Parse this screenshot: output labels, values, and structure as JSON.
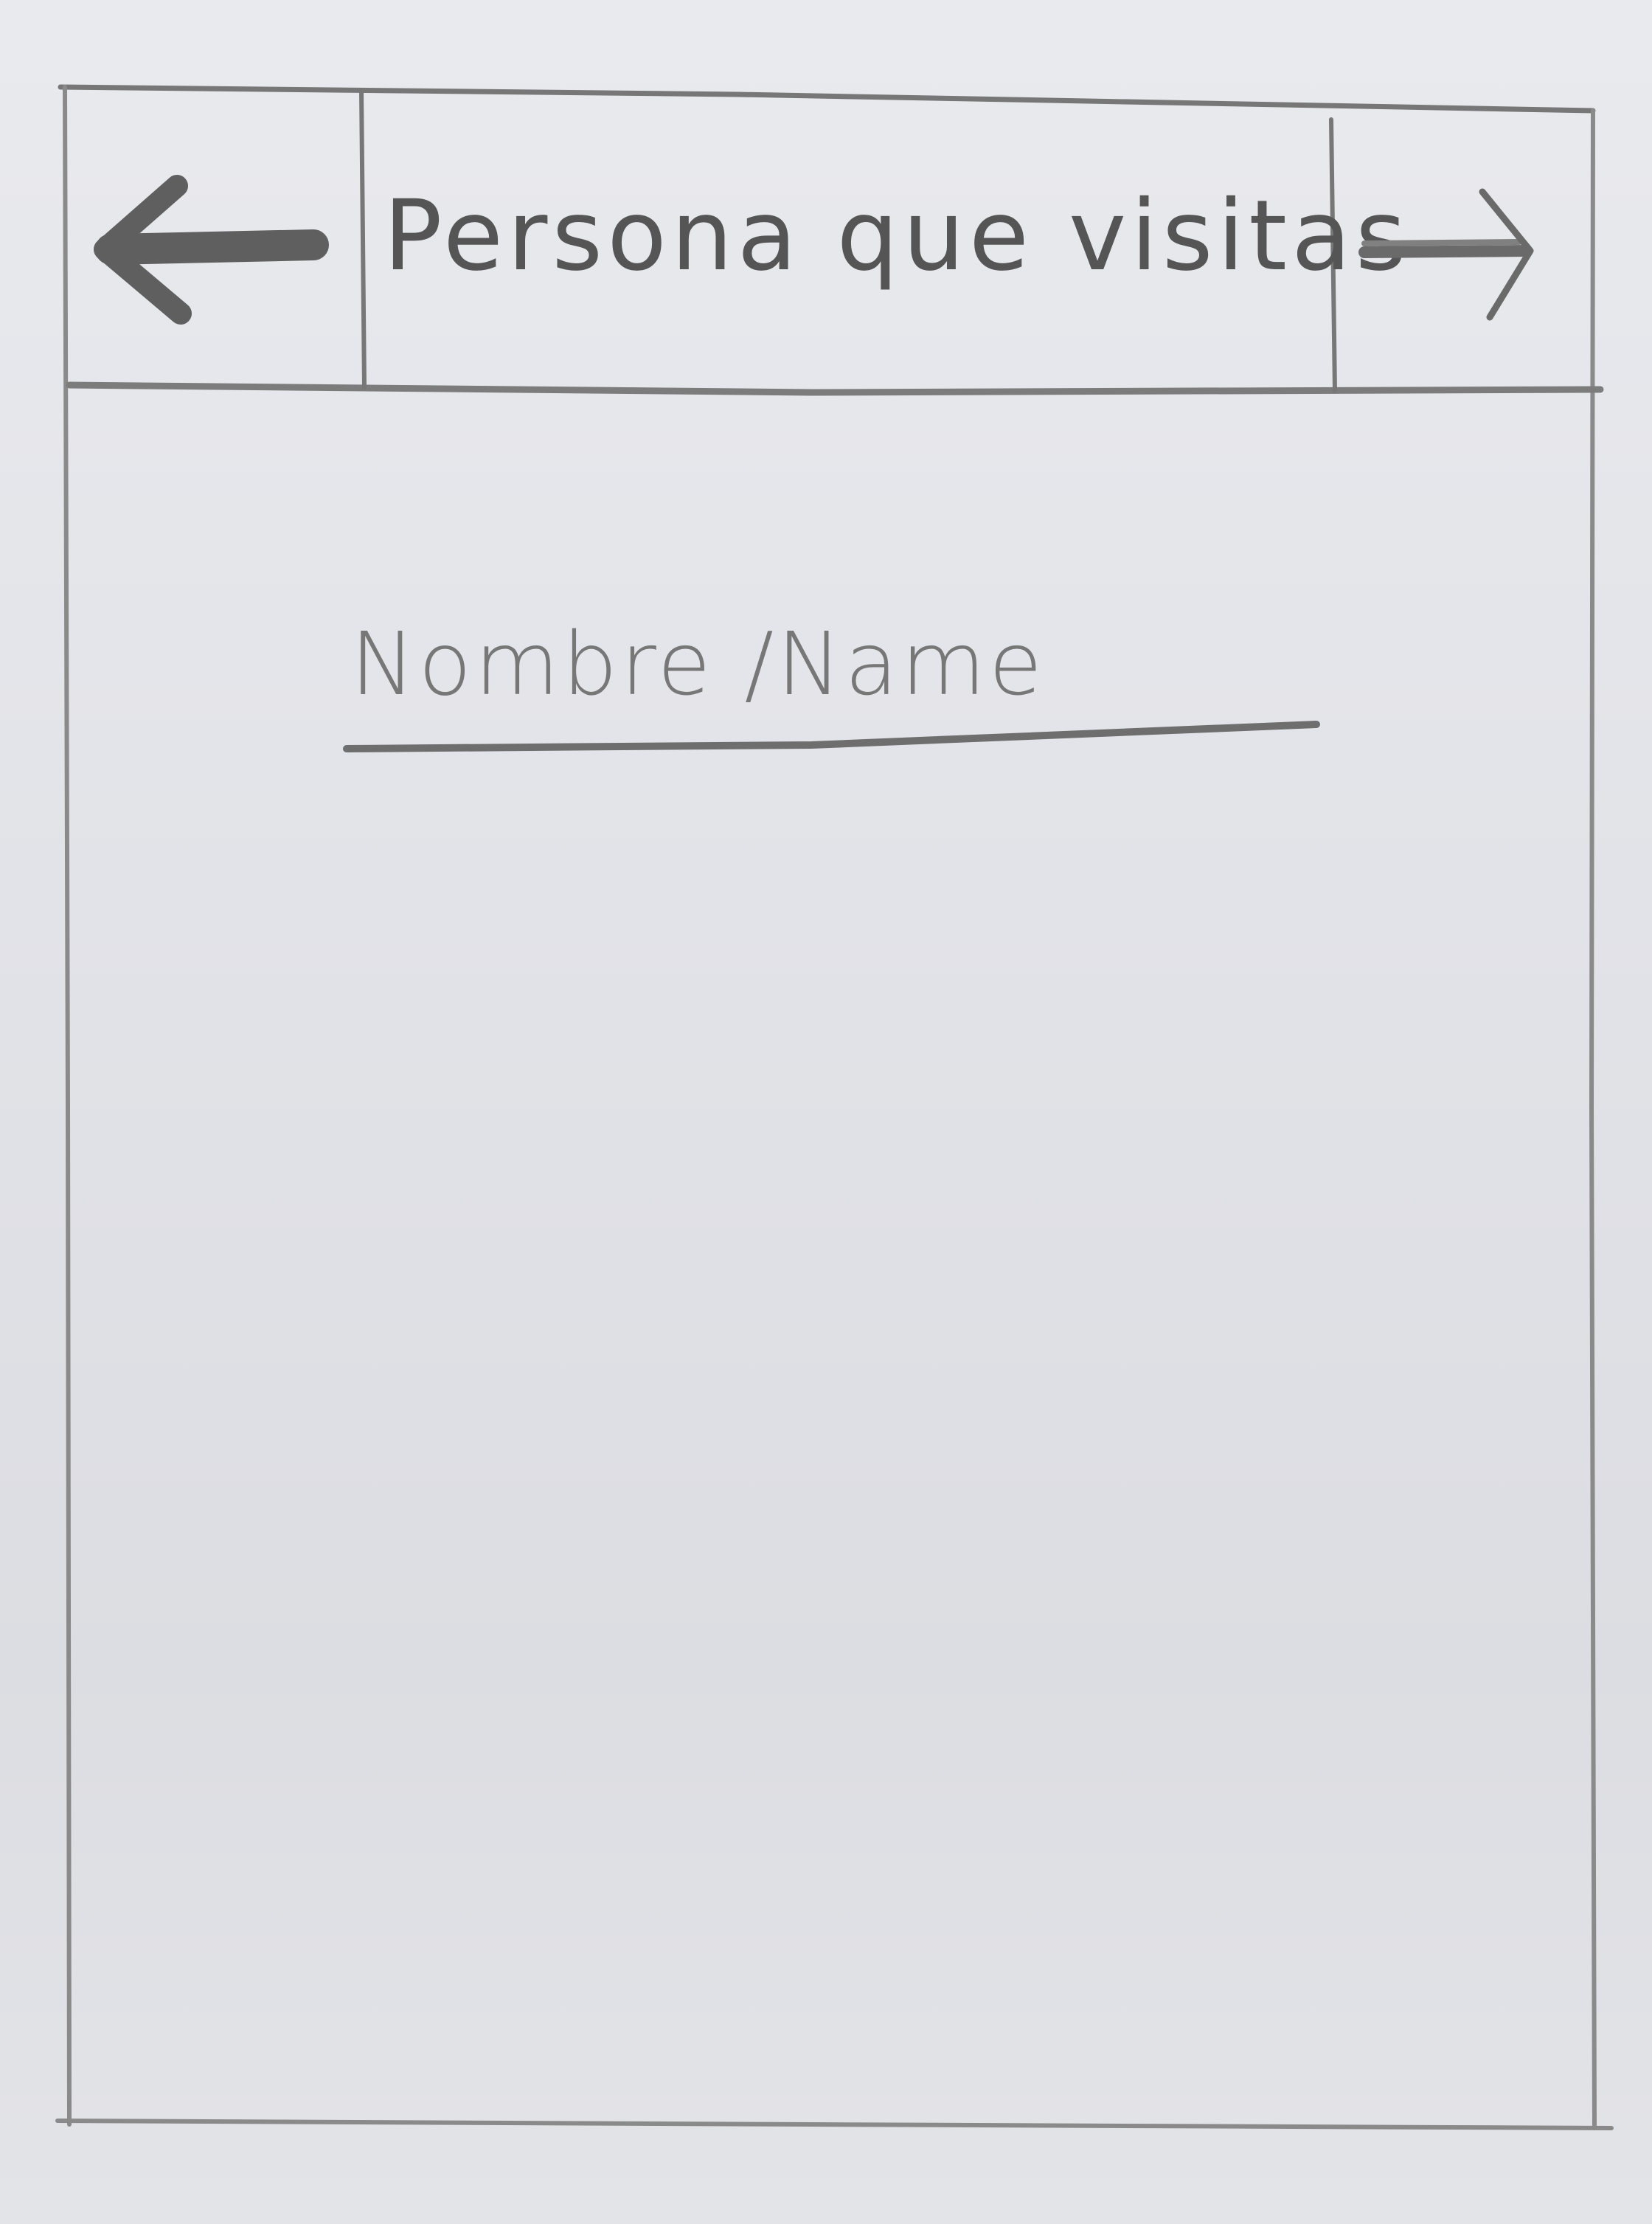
{
  "header": {
    "title": "Persona que visitas",
    "back_icon": "arrow-left-icon",
    "next_icon": "arrow-right-icon"
  },
  "form": {
    "name_field": {
      "placeholder": "Nombre /Name"
    }
  }
}
